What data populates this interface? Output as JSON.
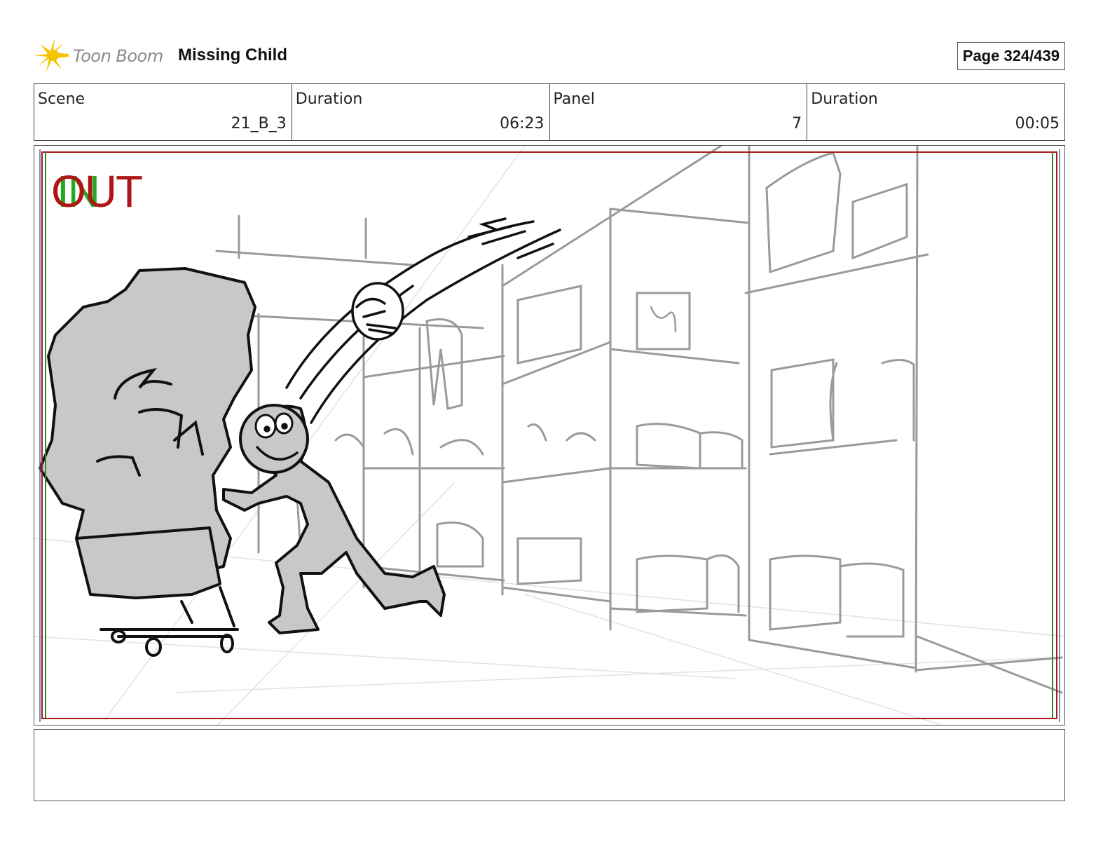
{
  "header": {
    "logo_text": "Toon Boom",
    "project_title": "Missing Child",
    "page_label": "Page 324/439"
  },
  "info": {
    "scene_label": "Scene",
    "scene_value": "21_B_3",
    "scene_duration_label": "Duration",
    "scene_duration_value": "06:23",
    "panel_label": "Panel",
    "panel_value": "7",
    "panel_duration_label": "Duration",
    "panel_duration_value": "00:05"
  },
  "panel": {
    "in_marker": "IN",
    "out_marker": "OUT"
  },
  "notes": {
    "text": ""
  },
  "colors": {
    "out_marker": "#b01515",
    "in_marker": "#22aa22",
    "safe_frame_red": "#b01515",
    "safe_frame_green": "#2a8a2a",
    "logo_yellow": "#f5c400"
  }
}
